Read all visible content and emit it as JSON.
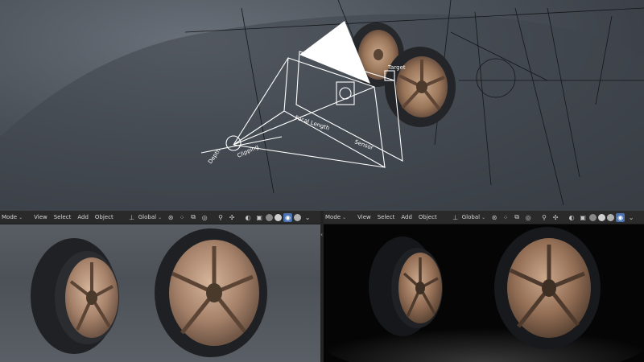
{
  "left_header": {
    "mode": "Mode",
    "menus": [
      "View",
      "Select",
      "Add",
      "Object"
    ],
    "transform_orientation": "Global"
  },
  "right_header": {
    "mode": "Mode",
    "menus": [
      "View",
      "Select",
      "Add",
      "Object"
    ],
    "transform_orientation": "Global"
  },
  "camera_labels": {
    "focal_length": "Focal Length",
    "target": "Target",
    "sensor": "Sensor",
    "clip_plane": "Clipping",
    "dof": "Depth"
  },
  "colors": {
    "header_bg": "#2a2a2a",
    "active_button": "#4a72b0",
    "rim_bronze": "#a8856a",
    "tire_black": "#1f2124"
  }
}
